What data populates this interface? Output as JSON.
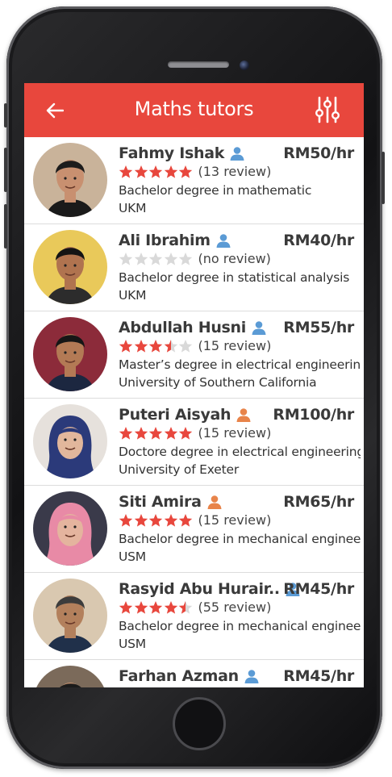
{
  "appbar": {
    "title": "Maths tutors",
    "back_icon": "arrow-left-icon",
    "filter_icon": "sliders-icon",
    "color": "#e8473d"
  },
  "colors": {
    "star_filled": "#e8473d",
    "star_empty": "#d9d9d9",
    "male_icon": "#5b9bd5",
    "female_icon": "#e8844a"
  },
  "tutors": [
    {
      "name": "Fahmy Ishak",
      "gender": "male",
      "price": "RM50/hr",
      "rating": 5,
      "review": "(13 review)",
      "degree": "Bachelor degree in mathematic",
      "university": "UKM"
    },
    {
      "name": "Ali Ibrahim",
      "gender": "male",
      "price": "RM40/hr",
      "rating": 0,
      "review": "(no review)",
      "degree": "Bachelor degree in statistical analysis",
      "university": "UKM"
    },
    {
      "name": "Abdullah Husni",
      "gender": "male",
      "price": "RM55/hr",
      "rating": 3.5,
      "review": "(15 review)",
      "degree": "Master’s degree in electrical engineering",
      "university": "University of Southern California"
    },
    {
      "name": "Puteri Aisyah",
      "gender": "female",
      "price": "RM100/hr",
      "rating": 5,
      "review": "(15 review)",
      "degree": "Doctore degree in electrical engineering",
      "university": "University of Exeter"
    },
    {
      "name": "Siti Amira",
      "gender": "female",
      "price": "RM65/hr",
      "rating": 5,
      "review": "(15 review)",
      "degree": "Bachelor degree in mechanical engineeri..",
      "university": "USM"
    },
    {
      "name": "Rasyid Abu Hurair..",
      "gender": "male",
      "price": "RM45/hr",
      "rating": 4.5,
      "review": "(55 review)",
      "degree": "Bachelor degree in mechanical engineeri..",
      "university": "USM"
    },
    {
      "name": "Farhan Azman",
      "gender": "male",
      "price": "RM45/hr",
      "rating": 0,
      "review": "",
      "degree": "",
      "university": ""
    }
  ]
}
